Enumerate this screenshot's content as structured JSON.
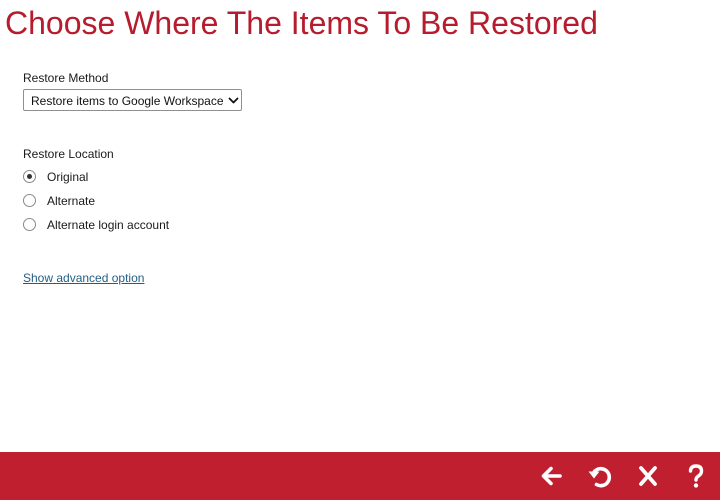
{
  "page": {
    "title": "Choose Where The Items To Be Restored"
  },
  "restore_method": {
    "label": "Restore Method",
    "selected_option": "Restore items to Google Workspace"
  },
  "restore_location": {
    "label": "Restore Location",
    "options": [
      {
        "label": "Original",
        "checked": true
      },
      {
        "label": "Alternate",
        "checked": false
      },
      {
        "label": "Alternate login account",
        "checked": false
      }
    ]
  },
  "advanced_link": {
    "label": "Show advanced option"
  },
  "footer": {
    "buttons": [
      {
        "icon": "arrow-left-icon",
        "action": "back"
      },
      {
        "icon": "restore-icon",
        "action": "restore"
      },
      {
        "icon": "close-icon",
        "action": "cancel"
      },
      {
        "icon": "help-icon",
        "action": "help"
      }
    ]
  },
  "colors": {
    "accent": "#b71c2e",
    "footer_background": "#c01f30",
    "link": "#1f5e86",
    "footer_icon": "#ffffff"
  }
}
